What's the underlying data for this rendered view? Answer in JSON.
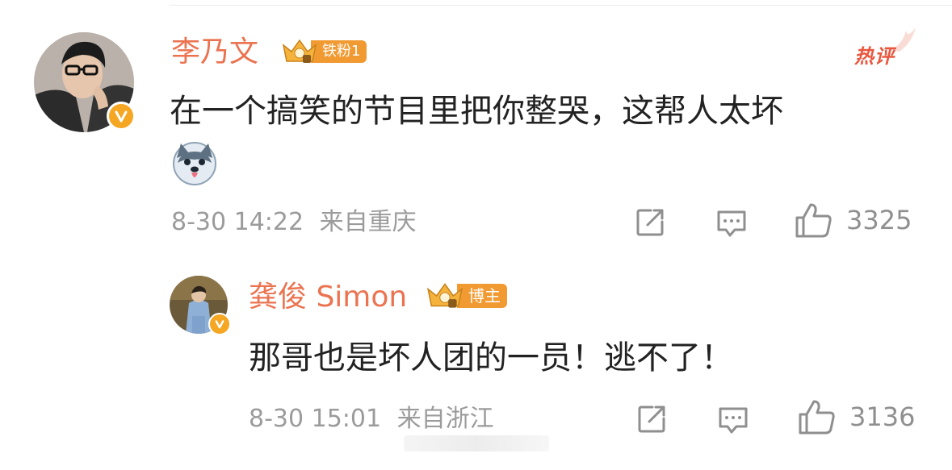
{
  "comments": [
    {
      "username": "李乃文",
      "badge_label": "铁粉1",
      "hot_label": "热评",
      "text": "在一个搞笑的节目里把你整哭，这帮人太坏",
      "emoji": "husky-face-emoji",
      "timestamp": "8-30 14:22",
      "location": "来自重庆",
      "like_count": "3325",
      "verified": true
    },
    {
      "username": "龚俊 Simon",
      "badge_label": "博主",
      "text": "那哥也是坏人团的一员！逃不了！",
      "timestamp": "8-30 15:01",
      "location": "来自浙江",
      "like_count": "3136",
      "verified": true
    }
  ],
  "colors": {
    "username": "#eb7350",
    "badge": "#f29a32",
    "verified": "#f5a623",
    "hot": "#e9573f",
    "text": "#222222",
    "meta": "#9b9b9b"
  },
  "icons": {
    "share": "share-icon",
    "comment": "comment-icon",
    "like": "thumbs-up-icon"
  }
}
